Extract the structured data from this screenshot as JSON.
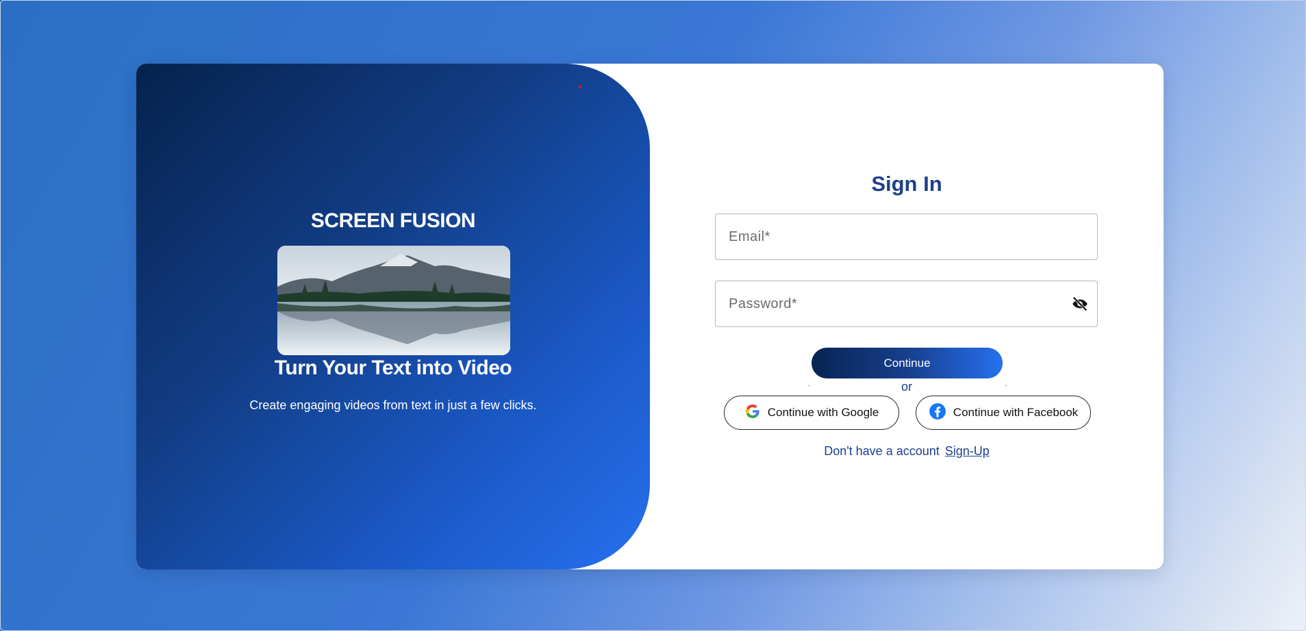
{
  "brand": {
    "name": "SCREEN FUSION"
  },
  "hero": {
    "tagline": "Turn Your Text into Video",
    "subtitle": "Create engaging videos from text in just a few clicks."
  },
  "signin": {
    "title": "Sign In",
    "email": {
      "value": "",
      "placeholder": "Email*"
    },
    "password": {
      "value": "",
      "placeholder": "Password*"
    },
    "continue_label": "Continue",
    "or_label": "or",
    "google_label": "Continue with Google",
    "facebook_label": "Continue with Facebook",
    "no_account_text": "Don't have a account",
    "signup_label": "Sign-Up"
  },
  "icons": {
    "password_toggle": "eye-off-icon",
    "google": "google-icon",
    "facebook": "facebook-icon"
  },
  "colors": {
    "accent": "#1c3f8c",
    "gradient_start": "#06224d",
    "gradient_end": "#2670ef"
  }
}
